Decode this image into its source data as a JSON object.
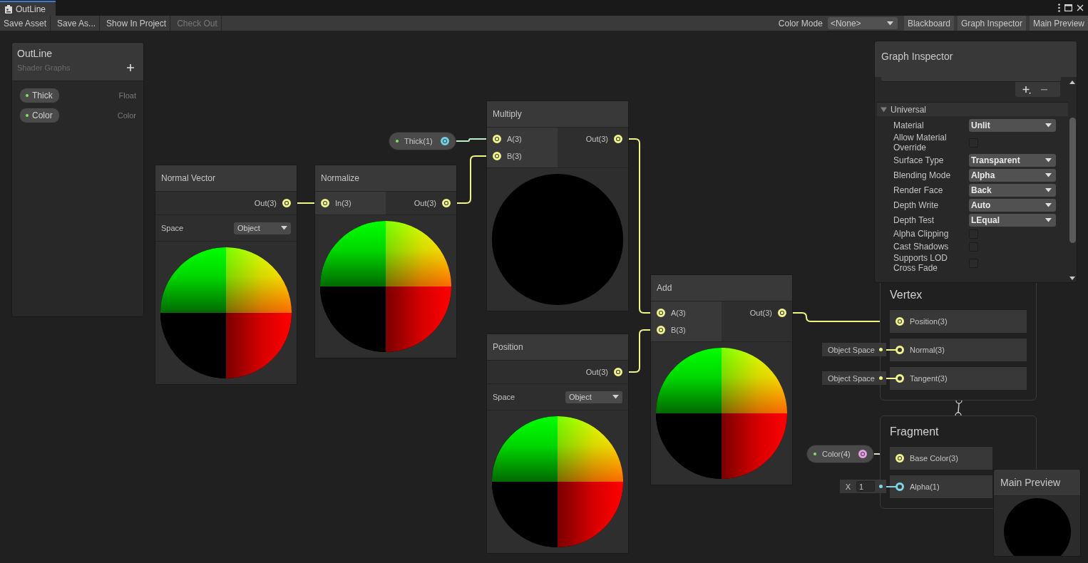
{
  "window": {
    "title": "OutLine"
  },
  "toolbar": {
    "buttons": [
      {
        "label": "Save Asset",
        "disabled": false
      },
      {
        "label": "Save As...",
        "disabled": false
      },
      {
        "label": "Show In Project",
        "disabled": false
      },
      {
        "label": "Check Out",
        "disabled": true
      }
    ],
    "color_mode": {
      "label": "Color Mode",
      "value": "<None>"
    },
    "toggles": [
      {
        "label": "Blackboard",
        "on": true
      },
      {
        "label": "Graph Inspector",
        "on": true
      },
      {
        "label": "Main Preview",
        "on": true
      }
    ]
  },
  "blackboard": {
    "title": "OutLine",
    "subtitle": "Shader Graphs",
    "properties": [
      {
        "name": "Thick",
        "type": "Float"
      },
      {
        "name": "Color",
        "type": "Color"
      }
    ]
  },
  "nodes": [
    {
      "title": "Normal Vector",
      "outputs": [
        "Out(3)"
      ],
      "controls": [
        {
          "label": "Space",
          "value": "Object"
        }
      ],
      "kind": "normals"
    },
    {
      "title": "Normalize",
      "inputs": [
        "In(3)"
      ],
      "outputs": [
        "Out(3)"
      ],
      "kind": "normals"
    },
    {
      "title": "Multiply",
      "inputs": [
        "A(3)",
        "B(3)"
      ],
      "outputs": [
        "Out(3)"
      ],
      "kind": "black"
    },
    {
      "title": "Position",
      "outputs": [
        "Out(3)"
      ],
      "controls": [
        {
          "label": "Space",
          "value": "Object"
        }
      ],
      "kind": "normals"
    },
    {
      "title": "Add",
      "inputs": [
        "A(3)",
        "B(3)"
      ],
      "outputs": [
        "Out(3)"
      ],
      "kind": "normals"
    }
  ],
  "property_nodes": [
    {
      "label": "Thick(1)",
      "color": "#6fd3e8"
    },
    {
      "label": "Color(4)",
      "color": "#e89ee8"
    }
  ],
  "master": {
    "vertex": {
      "title": "Vertex",
      "slots": [
        {
          "label": "Position(3)",
          "color": "#f2f58e",
          "connected": true
        },
        {
          "label": "Normal(3)",
          "color": "#f2f58e",
          "connected": false,
          "default": {
            "kind": "space",
            "text": "Object Space"
          }
        },
        {
          "label": "Tangent(3)",
          "color": "#f2f58e",
          "connected": false,
          "default": {
            "kind": "space",
            "text": "Object Space"
          }
        }
      ]
    },
    "fragment": {
      "title": "Fragment",
      "slots": [
        {
          "label": "Base Color(3)",
          "color": "#f2f58e",
          "connected": true
        },
        {
          "label": "Alpha(1)",
          "color": "#7ad6e8",
          "connected": false,
          "default": {
            "kind": "number",
            "axis": "X",
            "value": "1"
          }
        }
      ]
    }
  },
  "graph_inspector": {
    "title": "Graph Inspector",
    "section": {
      "title": "Universal",
      "expanded": true,
      "fields": [
        {
          "kind": "dropdown",
          "label": "Material",
          "value": "Unlit"
        },
        {
          "kind": "checkbox",
          "label": "Allow Material Override",
          "checked": false
        },
        {
          "kind": "dropdown",
          "label": "Surface Type",
          "value": "Transparent"
        },
        {
          "kind": "dropdown",
          "label": "Blending Mode",
          "value": "Alpha"
        },
        {
          "kind": "dropdown",
          "label": "Render Face",
          "value": "Back"
        },
        {
          "kind": "dropdown",
          "label": "Depth Write",
          "value": "Auto"
        },
        {
          "kind": "dropdown",
          "label": "Depth Test",
          "value": "LEqual"
        },
        {
          "kind": "checkbox",
          "label": "Alpha Clipping",
          "checked": false
        },
        {
          "kind": "checkbox",
          "label": "Cast Shadows",
          "checked": false
        },
        {
          "kind": "checkbox",
          "label": "Supports LOD Cross Fade",
          "checked": false
        }
      ]
    }
  },
  "main_preview": {
    "title": "Main Preview"
  }
}
